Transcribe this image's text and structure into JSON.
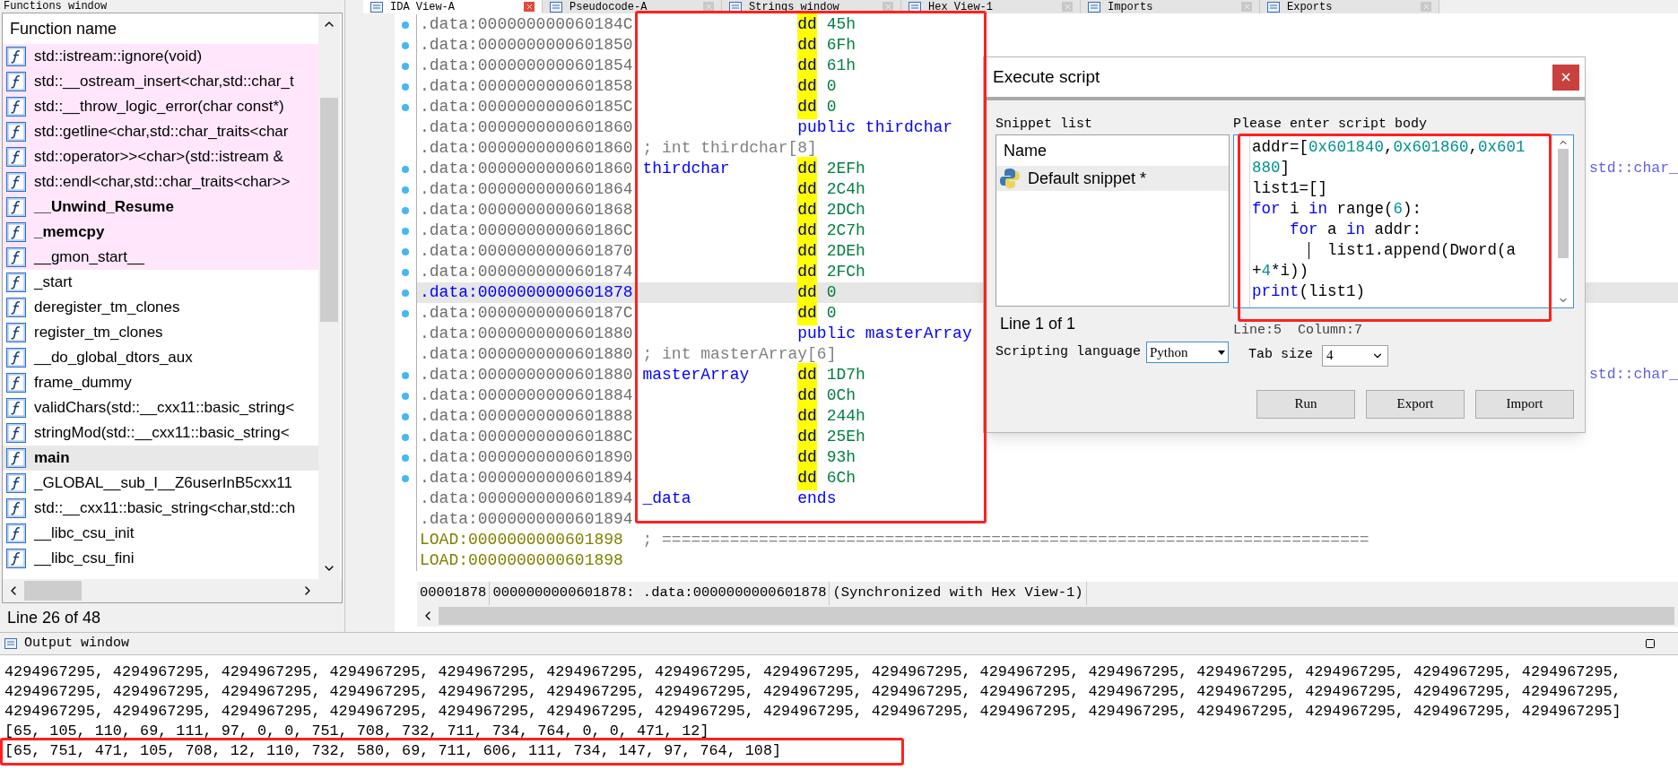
{
  "functions_window": {
    "title": "Functions window",
    "column": "Function name",
    "items": [
      {
        "name": "std::istream::ignore(void)",
        "bold": false,
        "imported": true,
        "selected": false
      },
      {
        "name": "std::__ostream_insert<char,std::char_t",
        "bold": false,
        "imported": true,
        "selected": false
      },
      {
        "name": "std::__throw_logic_error(char const*)",
        "bold": false,
        "imported": true,
        "selected": false
      },
      {
        "name": "std::getline<char,std::char_traits<char",
        "bold": false,
        "imported": true,
        "selected": false
      },
      {
        "name": "std::operator>><char>(std::istream &",
        "bold": false,
        "imported": true,
        "selected": false
      },
      {
        "name": "std::endl<char,std::char_traits<char>>",
        "bold": false,
        "imported": true,
        "selected": false
      },
      {
        "name": "__Unwind_Resume",
        "bold": true,
        "imported": true,
        "selected": false
      },
      {
        "name": "_memcpy",
        "bold": true,
        "imported": true,
        "selected": false
      },
      {
        "name": "__gmon_start__",
        "bold": false,
        "imported": true,
        "selected": false
      },
      {
        "name": "_start",
        "bold": false,
        "imported": false,
        "selected": false
      },
      {
        "name": "deregister_tm_clones",
        "bold": false,
        "imported": false,
        "selected": false
      },
      {
        "name": "register_tm_clones",
        "bold": false,
        "imported": false,
        "selected": false
      },
      {
        "name": "__do_global_dtors_aux",
        "bold": false,
        "imported": false,
        "selected": false
      },
      {
        "name": "frame_dummy",
        "bold": false,
        "imported": false,
        "selected": false
      },
      {
        "name": "validChars(std::__cxx11::basic_string<",
        "bold": false,
        "imported": false,
        "selected": false
      },
      {
        "name": "stringMod(std::__cxx11::basic_string<",
        "bold": false,
        "imported": false,
        "selected": false
      },
      {
        "name": "main",
        "bold": true,
        "imported": false,
        "selected": true
      },
      {
        "name": "_GLOBAL__sub_I__Z6userInB5cxx11",
        "bold": false,
        "imported": false,
        "selected": false
      },
      {
        "name": "std::__cxx11::basic_string<char,std::ch",
        "bold": false,
        "imported": false,
        "selected": false
      },
      {
        "name": "__libc_csu_init",
        "bold": false,
        "imported": false,
        "selected": false
      },
      {
        "name": "__libc_csu_fini",
        "bold": false,
        "imported": false,
        "selected": false
      }
    ],
    "status": "Line 26 of 48"
  },
  "tabs": [
    {
      "label": "IDA View-A",
      "selected": true
    },
    {
      "label": "Pseudocode-A",
      "selected": false
    },
    {
      "label": "Strings window",
      "selected": false
    },
    {
      "label": "Hex View-1",
      "selected": false
    },
    {
      "label": "Imports",
      "selected": false
    },
    {
      "label": "Exports",
      "selected": false
    }
  ],
  "listing": {
    "framed": true,
    "rows": [
      {
        "kind": "data",
        "address": ".data:000000000060184C",
        "mnemonic": "dd",
        "operand": "45h",
        "highlighted": true,
        "bullet": true,
        "selected": false
      },
      {
        "kind": "data",
        "address": ".data:0000000000601850",
        "mnemonic": "dd",
        "operand": "6Fh",
        "highlighted": true,
        "bullet": true,
        "selected": false
      },
      {
        "kind": "data",
        "address": ".data:0000000000601854",
        "mnemonic": "dd",
        "operand": "61h",
        "highlighted": true,
        "bullet": true,
        "selected": false
      },
      {
        "kind": "data",
        "address": ".data:0000000000601858",
        "mnemonic": "dd",
        "operand": "0",
        "highlighted": true,
        "bullet": true,
        "selected": false
      },
      {
        "kind": "data",
        "address": ".data:000000000060185C",
        "mnemonic": "dd",
        "operand": "0",
        "highlighted": true,
        "bullet": true,
        "selected": false
      },
      {
        "kind": "data",
        "address": ".data:0000000000601860",
        "mnemonic": "public",
        "operand": "thirdchar",
        "highlighted": false,
        "bullet": false,
        "selected": false
      },
      {
        "kind": "data",
        "address": ".data:0000000000601860",
        "comment": "; int thirdchar[8]",
        "bullet": false,
        "selected": false
      },
      {
        "kind": "data",
        "address": ".data:0000000000601860",
        "label": "thirdchar",
        "mnemonic": "dd",
        "operand": "2EFh",
        "highlighted": true,
        "xref": "std::char_",
        "bullet": true,
        "selected": false
      },
      {
        "kind": "data",
        "address": ".data:0000000000601864",
        "mnemonic": "dd",
        "operand": "2C4h",
        "highlighted": true,
        "bullet": true,
        "selected": false
      },
      {
        "kind": "data",
        "address": ".data:0000000000601868",
        "mnemonic": "dd",
        "operand": "2DCh",
        "highlighted": true,
        "bullet": true,
        "selected": false
      },
      {
        "kind": "data",
        "address": ".data:000000000060186C",
        "mnemonic": "dd",
        "operand": "2C7h",
        "highlighted": true,
        "bullet": true,
        "selected": false
      },
      {
        "kind": "data",
        "address": ".data:0000000000601870",
        "mnemonic": "dd",
        "operand": "2DEh",
        "highlighted": true,
        "bullet": true,
        "selected": false
      },
      {
        "kind": "data",
        "address": ".data:0000000000601874",
        "mnemonic": "dd",
        "operand": "2FCh",
        "highlighted": true,
        "bullet": true,
        "selected": false
      },
      {
        "kind": "data",
        "address": ".data:0000000000601878",
        "mnemonic": "dd",
        "operand": "0",
        "highlighted": true,
        "bullet": true,
        "selected": true
      },
      {
        "kind": "data",
        "address": ".data:000000000060187C",
        "mnemonic": "dd",
        "operand": "0",
        "highlighted": true,
        "bullet": true,
        "selected": false
      },
      {
        "kind": "data",
        "address": ".data:0000000000601880",
        "mnemonic": "public",
        "operand": "masterArray",
        "highlighted": false,
        "bullet": false,
        "selected": false
      },
      {
        "kind": "data",
        "address": ".data:0000000000601880",
        "comment": "; int masterArray[6]",
        "bullet": false,
        "selected": false
      },
      {
        "kind": "data",
        "address": ".data:0000000000601880",
        "label": "masterArray",
        "mnemonic": "dd",
        "operand": "1D7h",
        "highlighted": true,
        "xref": "std::char_",
        "bullet": true,
        "selected": false
      },
      {
        "kind": "data",
        "address": ".data:0000000000601884",
        "mnemonic": "dd",
        "operand": "0Ch",
        "highlighted": true,
        "bullet": true,
        "selected": false
      },
      {
        "kind": "data",
        "address": ".data:0000000000601888",
        "mnemonic": "dd",
        "operand": "244h",
        "highlighted": true,
        "bullet": true,
        "selected": false
      },
      {
        "kind": "data",
        "address": ".data:000000000060188C",
        "mnemonic": "dd",
        "operand": "25Eh",
        "highlighted": true,
        "bullet": true,
        "selected": false
      },
      {
        "kind": "data",
        "address": ".data:0000000000601890",
        "mnemonic": "dd",
        "operand": "93h",
        "highlighted": true,
        "bullet": true,
        "selected": false
      },
      {
        "kind": "data",
        "address": ".data:0000000000601894",
        "mnemonic": "dd",
        "operand": "6Ch",
        "highlighted": true,
        "bullet": true,
        "selected": false
      },
      {
        "kind": "data",
        "address": ".data:0000000000601894",
        "label": "_data",
        "mnemonic": "ends",
        "highlighted": false,
        "bullet": false,
        "selected": false
      },
      {
        "kind": "data",
        "address": ".data:0000000000601894",
        "bullet": false,
        "selected": false
      },
      {
        "kind": "load",
        "address": "LOAD:0000000000601898",
        "comment": "; =========================================================================",
        "bullet": false,
        "selected": false
      },
      {
        "kind": "load",
        "address": "LOAD:0000000000601898",
        "bullet": false,
        "selected": false
      }
    ],
    "status_cells": [
      "00001878",
      "0000000000601878: .data:0000000000601878",
      "(Synchronized with Hex View-1)"
    ]
  },
  "dialog": {
    "title": "Execute script",
    "snippet_label": "Snippet list",
    "snippet_column": "Name",
    "snippets": [
      {
        "name": "Default snippet *",
        "selected": true
      }
    ],
    "snippet_status": "Line 1 of 1",
    "language_label": "Scripting language",
    "language": "Python",
    "body_label": "Please enter script body",
    "code_framed": true,
    "code": [
      {
        "tokens": [
          {
            "text": "addr=[",
            "kind": "plain"
          },
          {
            "text": "0x601840",
            "kind": "number"
          },
          {
            "text": ",",
            "kind": "plain"
          },
          {
            "text": "0x601860",
            "kind": "number"
          },
          {
            "text": ",",
            "kind": "plain"
          },
          {
            "text": "0x601",
            "kind": "number"
          }
        ]
      },
      {
        "tokens": [
          {
            "text": "880",
            "kind": "number"
          },
          {
            "text": "]",
            "kind": "plain"
          }
        ]
      },
      {
        "tokens": [
          {
            "text": "list1=[]",
            "kind": "plain"
          }
        ]
      },
      {
        "tokens": [
          {
            "text": "for",
            "kind": "keyword"
          },
          {
            "text": " i ",
            "kind": "plain"
          },
          {
            "text": "in",
            "kind": "keyword"
          },
          {
            "text": " range(",
            "kind": "plain"
          },
          {
            "text": "6",
            "kind": "number"
          },
          {
            "text": "):",
            "kind": "plain"
          }
        ]
      },
      {
        "tokens": [
          {
            "text": "    for",
            "kind": "keyword"
          },
          {
            "text": " a ",
            "kind": "plain"
          },
          {
            "text": "in",
            "kind": "keyword"
          },
          {
            "text": " addr:",
            "kind": "plain"
          }
        ]
      },
      {
        "guide": true,
        "tokens": [
          {
            "text": "        list1.append(Dword(a",
            "kind": "plain"
          }
        ]
      },
      {
        "tokens": [
          {
            "text": "+",
            "kind": "plain"
          },
          {
            "text": "4",
            "kind": "number"
          },
          {
            "text": "*i))",
            "kind": "plain"
          }
        ]
      },
      {
        "tokens": [
          {
            "text": "print",
            "kind": "keyword"
          },
          {
            "text": "(list1)",
            "kind": "plain"
          }
        ]
      }
    ],
    "cursor": "Line:5  Column:7",
    "tab_size_label": "Tab size",
    "tab_size": "4",
    "buttons": [
      "Run",
      "Export",
      "Import"
    ]
  },
  "output": {
    "title": "Output window",
    "lines": [
      {
        "text": "4294967295, 4294967295, 4294967295, 4294967295, 4294967295, 4294967295, 4294967295, 4294967295, 4294967295, 4294967295, 4294967295, 4294967295, 4294967295, 4294967295, 4294967295,",
        "framed": false
      },
      {
        "text": "4294967295, 4294967295, 4294967295, 4294967295, 4294967295, 4294967295, 4294967295, 4294967295, 4294967295, 4294967295, 4294967295, 4294967295, 4294967295, 4294967295, 4294967295,",
        "framed": false
      },
      {
        "text": "4294967295, 4294967295, 4294967295, 4294967295, 4294967295, 4294967295, 4294967295, 4294967295, 4294967295, 4294967295, 4294967295, 4294967295, 4294967295, 4294967295, 4294967295]",
        "framed": false
      },
      {
        "text": "[65, 105, 110, 69, 111, 97, 0, 0, 751, 708, 732, 711, 734, 764, 0, 0, 471, 12]",
        "framed": false
      },
      {
        "text": "[65, 751, 471, 105, 708, 12, 110, 732, 580, 69, 711, 606, 111, 734, 147, 97, 764, 108]",
        "framed": true
      }
    ]
  }
}
